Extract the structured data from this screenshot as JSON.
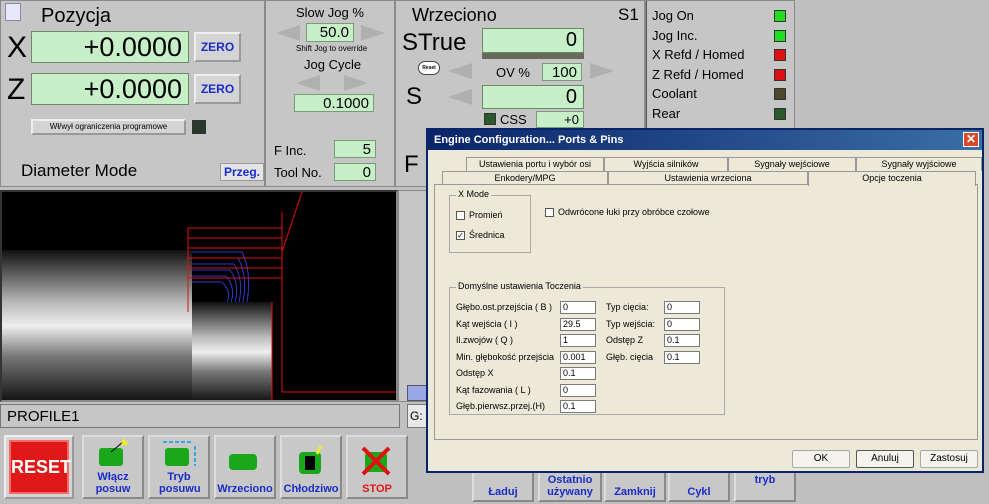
{
  "position": {
    "title": "Pozycja",
    "x_label": "X",
    "x_value": "+0.0000",
    "z_label": "Z",
    "z_value": "+0.0000",
    "zero_label": "ZERO",
    "soft_limits_label": "Wł/wył ograniczenia programowe",
    "diameter_mode": "Diameter Mode",
    "przeg_label": "Przeg."
  },
  "jog": {
    "slow_jog_label": "Slow Jog %",
    "slow_jog_value": "50.0",
    "shift_hint": "Shift Jog to override",
    "jog_cycle_label": "Jog Cycle",
    "jog_cycle_value": "0.1000",
    "finc_label": "F Inc.",
    "finc_value": "5",
    "tool_label": "Tool No.",
    "tool_value": "0"
  },
  "spindle": {
    "title": "Wrzeciono",
    "s1_label": "S1",
    "strue_label": "STrue",
    "strue_value": "0",
    "reset_small": "Reset",
    "ov_label": "OV %",
    "ov_value": "100",
    "s_label": "S",
    "s_value": "0",
    "css_label": "CSS",
    "css_value": "+0",
    "f_label": "F"
  },
  "status": {
    "items": [
      {
        "label": "Jog On",
        "color": "#22dd22"
      },
      {
        "label": "Jog Inc.",
        "color": "#22dd22"
      },
      {
        "label": "X Refd / Homed",
        "color": "#dd1111"
      },
      {
        "label": "Z Refd / Homed",
        "color": "#dd1111"
      },
      {
        "label": "Coolant",
        "color": "#4a4a2a"
      },
      {
        "label": "Rear",
        "color": "#2a5a2a"
      }
    ]
  },
  "profile": {
    "name": "PROFILE1",
    "gcode_prefix": "G:"
  },
  "bottom_buttons": {
    "reset": "RESET",
    "enable_feed": "Włącz posuw",
    "feed_mode": "Tryb posuwu",
    "spindle": "Wrzeciono",
    "coolant": "Chłodziwo",
    "stop": "STOP",
    "load": "Ładuj",
    "last_used": "Ostatnio używany",
    "close": "Zamknij",
    "cycle": "Cykl",
    "mode": "tryb"
  },
  "dialog": {
    "title": "Engine Configuration... Ports & Pins",
    "tabs_row1": [
      "Ustawienia portu i wybór osi",
      "Wyjścia silników",
      "Sygnały wejściowe",
      "Sygnały wyjściowe"
    ],
    "tabs_row2": [
      "Enkodery/MPG",
      "Ustawienia wrzeciona",
      "Opcje toczenia"
    ],
    "xmode_group": "X Mode",
    "radius_label": "Promień",
    "diameter_label": "Średnica",
    "reversed_arcs_label": "Odwrócone łuki przy obróbce czołowe",
    "defaults_group": "Domyślne ustawienia Toczenia",
    "fields_left": [
      {
        "label": "Głębo.ost.przejścia ( B )",
        "value": "0"
      },
      {
        "label": "Kąt wejścia ( I )",
        "value": "29.5"
      },
      {
        "label": "Il.zwojów ( Q )",
        "value": "1"
      },
      {
        "label": "Min. głębokość przejścia",
        "value": "0.001"
      },
      {
        "label": "Odstęp X",
        "value": "0.1"
      },
      {
        "label": "Kąt fazowania ( L )",
        "value": "0"
      },
      {
        "label": "Głęb.pierwsz.przej.(H)",
        "value": "0.1"
      }
    ],
    "fields_right": [
      {
        "label": "Typ cięcia:",
        "value": "0"
      },
      {
        "label": "Typ wejścia:",
        "value": "0"
      },
      {
        "label": "Odstęp Z",
        "value": "0.1"
      },
      {
        "label": "Głęb. cięcia",
        "value": "0.1"
      }
    ],
    "ok_label": "OK",
    "cancel_label": "Anuluj",
    "apply_label": "Zastosuj"
  }
}
